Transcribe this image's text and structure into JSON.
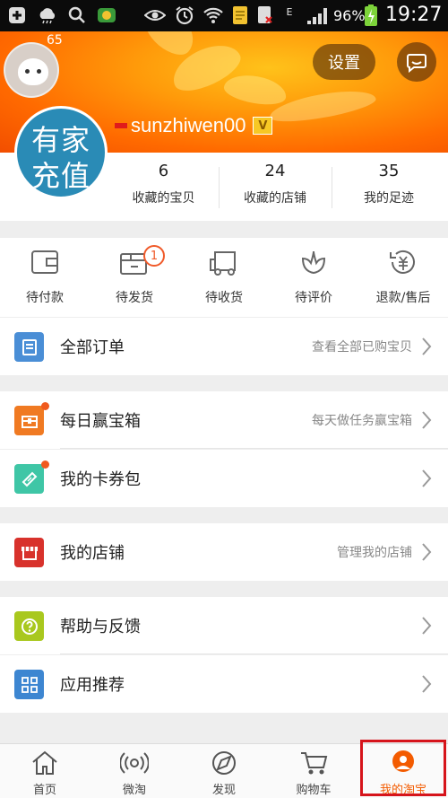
{
  "status_bar": {
    "battery_percent": "96%",
    "time": "19:27",
    "network_label": "E"
  },
  "header": {
    "avatar_count": "65",
    "settings_label": "设置",
    "username": "sunzhiwen00",
    "vip_badge": "V"
  },
  "profile": {
    "pic_line1": "有家",
    "pic_line2": "充值"
  },
  "stats": [
    {
      "value": "6",
      "label": "收藏的宝贝"
    },
    {
      "value": "24",
      "label": "收藏的店铺"
    },
    {
      "value": "35",
      "label": "我的足迹"
    }
  ],
  "orders": [
    {
      "label": "待付款",
      "icon": "wallet-icon"
    },
    {
      "label": "待发货",
      "icon": "box-icon",
      "badge": "1"
    },
    {
      "label": "待收货",
      "icon": "truck-icon"
    },
    {
      "label": "待评价",
      "icon": "flower-icon"
    },
    {
      "label": "退款/售后",
      "icon": "refund-icon"
    }
  ],
  "rows": {
    "all_orders": {
      "title": "全部订单",
      "sub": "查看全部已购宝贝",
      "color": "#4a8ed6"
    },
    "daily_box": {
      "title": "每日赢宝箱",
      "sub": "每天做任务赢宝箱",
      "color": "#f07a22"
    },
    "coupons": {
      "title": "我的卡券包",
      "sub": "",
      "color": "#3fc6a6"
    },
    "my_shop": {
      "title": "我的店铺",
      "sub": "管理我的店铺",
      "color": "#d8322c"
    },
    "help": {
      "title": "帮助与反馈",
      "sub": "",
      "color": "#a9c81e"
    },
    "apps": {
      "title": "应用推荐",
      "sub": "",
      "color": "#3d86d1"
    }
  },
  "bottom_nav": [
    {
      "label": "首页",
      "icon": "home-icon"
    },
    {
      "label": "微淘",
      "icon": "broadcast-icon"
    },
    {
      "label": "发现",
      "icon": "discover-icon"
    },
    {
      "label": "购物车",
      "icon": "cart-icon"
    },
    {
      "label": "我的淘宝",
      "icon": "my-taobao-icon",
      "active": true
    }
  ],
  "colors": {
    "accent": "#f35b00",
    "highlight_border": "#d6141b"
  }
}
